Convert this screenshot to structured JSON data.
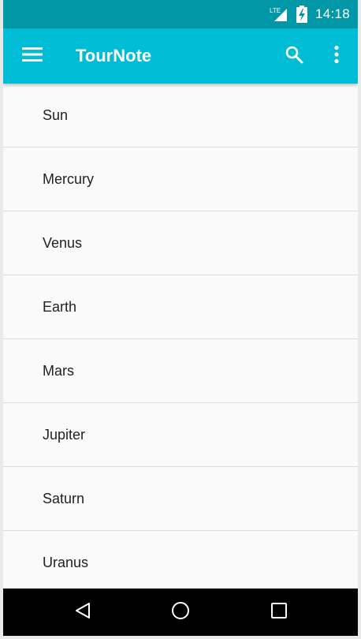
{
  "status_bar": {
    "network_label": "LTE",
    "time": "14:18",
    "icons": [
      "signal-icon",
      "battery-charging-icon"
    ]
  },
  "app_bar": {
    "title": "TourNote",
    "icons": [
      "menu-icon",
      "search-icon",
      "more-vert-icon"
    ],
    "color": "#00bcd4",
    "status_color": "#0097a7"
  },
  "list": {
    "items": [
      "Sun",
      "Mercury",
      "Venus",
      "Earth",
      "Mars",
      "Jupiter",
      "Saturn",
      "Uranus"
    ]
  },
  "nav_bar": {
    "icons": [
      "back-icon",
      "home-icon",
      "recents-icon"
    ]
  }
}
